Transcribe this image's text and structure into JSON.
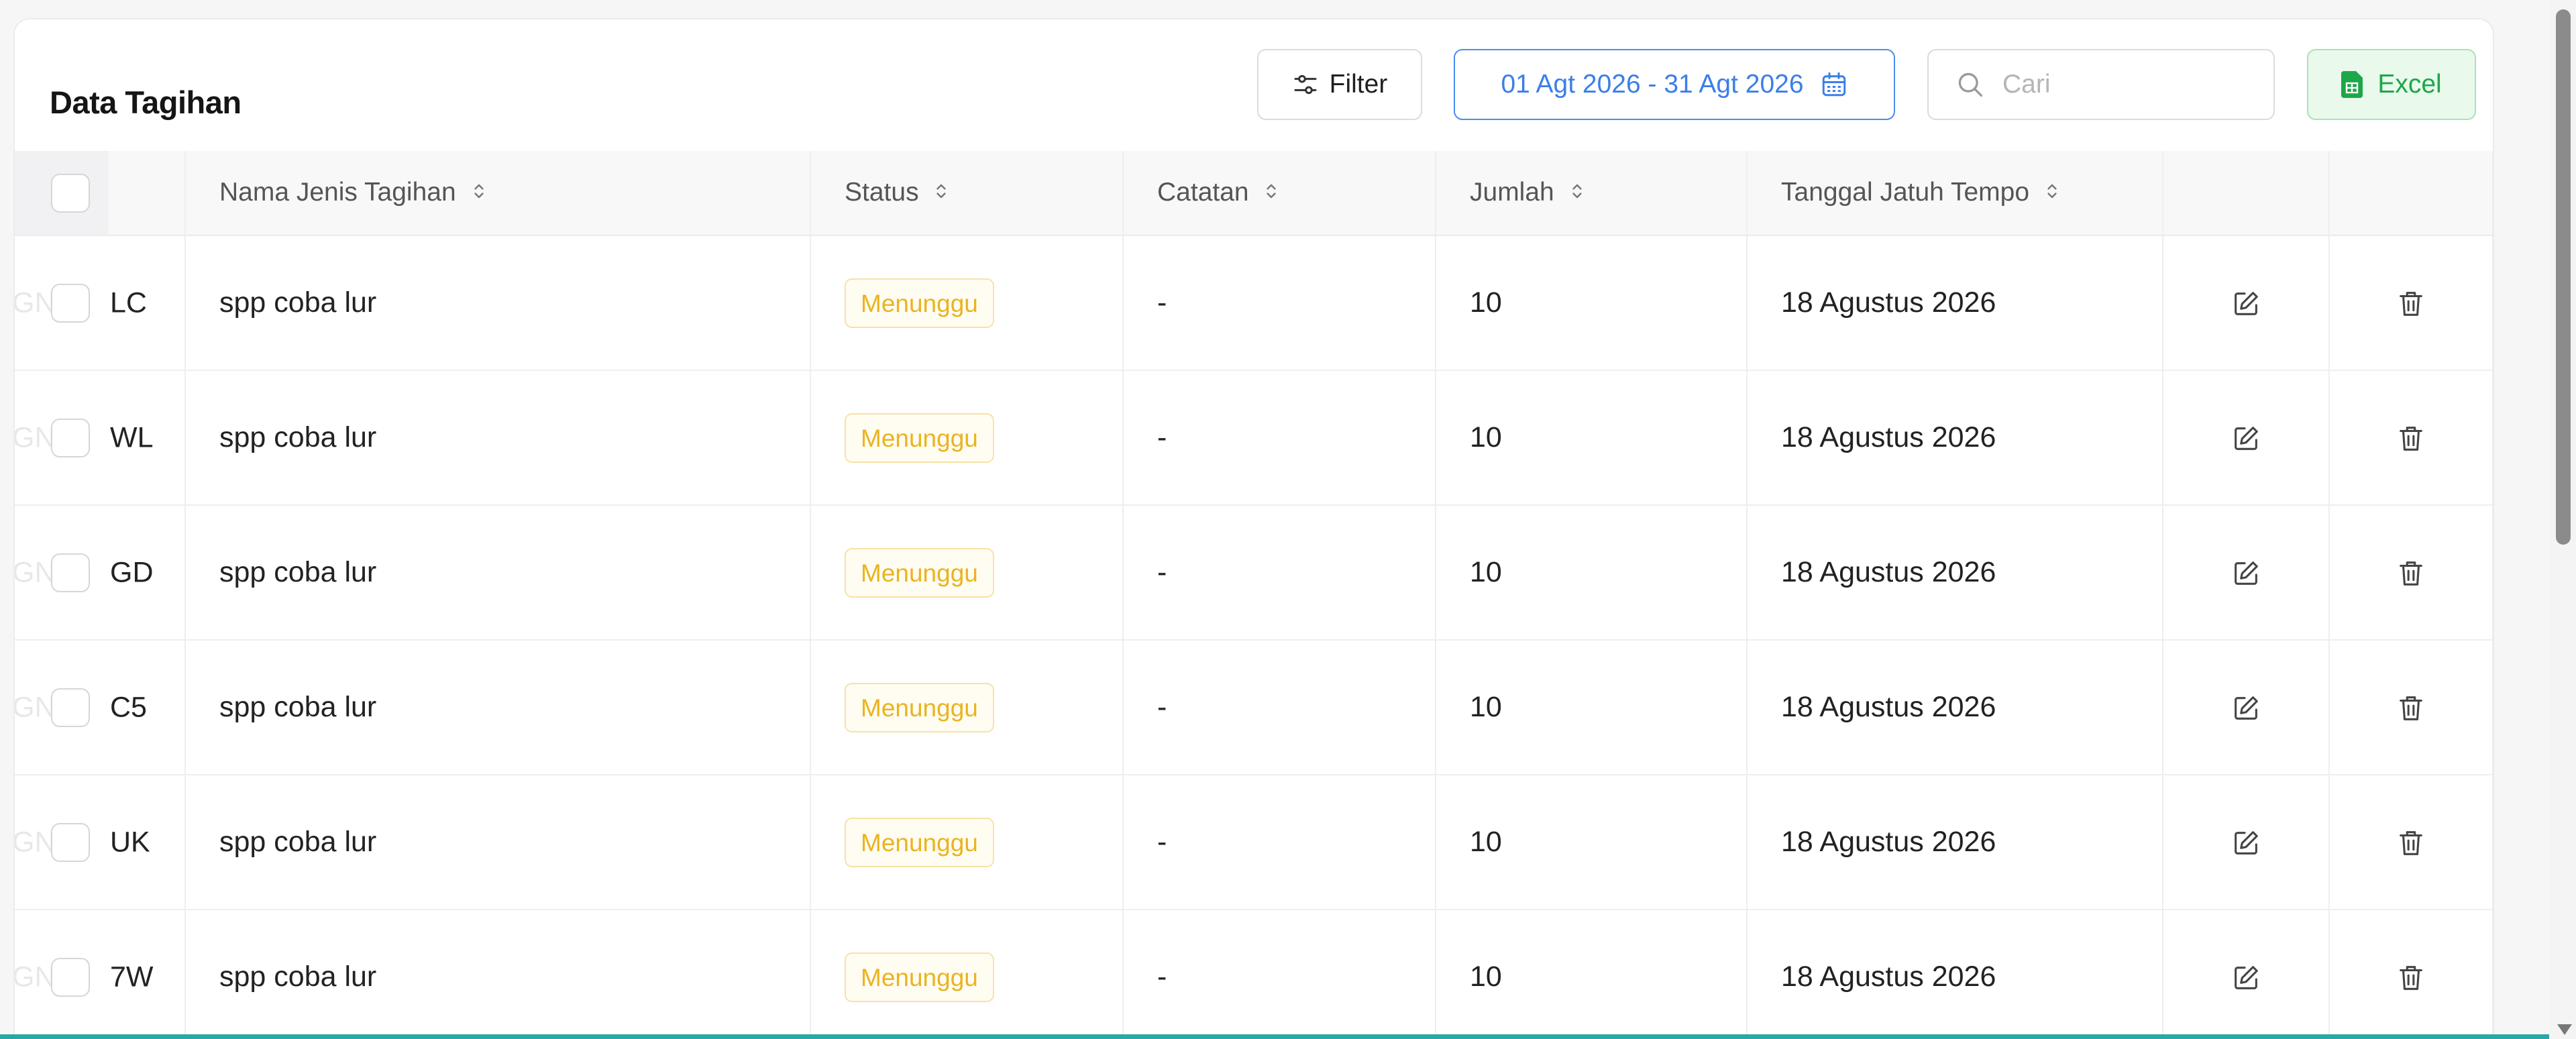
{
  "header": {
    "title": "Data Tagihan",
    "filter_label": "Filter",
    "date_range": "01 Agt 2026 - 31 Agt 2026",
    "search_placeholder": "Cari",
    "excel_label": "Excel"
  },
  "columns": [
    "Nama Jenis Tagihan",
    "Status",
    "Catatan",
    "Jumlah",
    "Tanggal Jatuh Tempo"
  ],
  "rows": [
    {
      "code_hidden": "GN",
      "code": "LC",
      "name": "spp coba lur",
      "status": "Menunggu",
      "note": "-",
      "amount": "10",
      "due": "18 Agustus 2026"
    },
    {
      "code_hidden": "GN",
      "code": "WL",
      "name": "spp coba lur",
      "status": "Menunggu",
      "note": "-",
      "amount": "10",
      "due": "18 Agustus 2026"
    },
    {
      "code_hidden": "GN",
      "code": "GD",
      "name": "spp coba lur",
      "status": "Menunggu",
      "note": "-",
      "amount": "10",
      "due": "18 Agustus 2026"
    },
    {
      "code_hidden": "GN",
      "code": "C5",
      "name": "spp coba lur",
      "status": "Menunggu",
      "note": "-",
      "amount": "10",
      "due": "18 Agustus 2026"
    },
    {
      "code_hidden": "GN",
      "code": "UK",
      "name": "spp coba lur",
      "status": "Menunggu",
      "note": "-",
      "amount": "10",
      "due": "18 Agustus 2026"
    },
    {
      "code_hidden": "GN",
      "code": "7W",
      "name": "spp coba lur",
      "status": "Menunggu",
      "note": "-",
      "amount": "10",
      "due": "18 Agustus 2026"
    }
  ],
  "icons": {
    "filter": "sliders-icon",
    "date": "calendar-icon",
    "search": "search-icon",
    "excel": "spreadsheet-icon",
    "sort": "sort-icon",
    "edit": "edit-icon",
    "delete": "trash-icon"
  },
  "colors": {
    "accent_blue": "#3b7ee8",
    "excel_green": "#1ea64a",
    "status_pending": "#eab41f"
  }
}
